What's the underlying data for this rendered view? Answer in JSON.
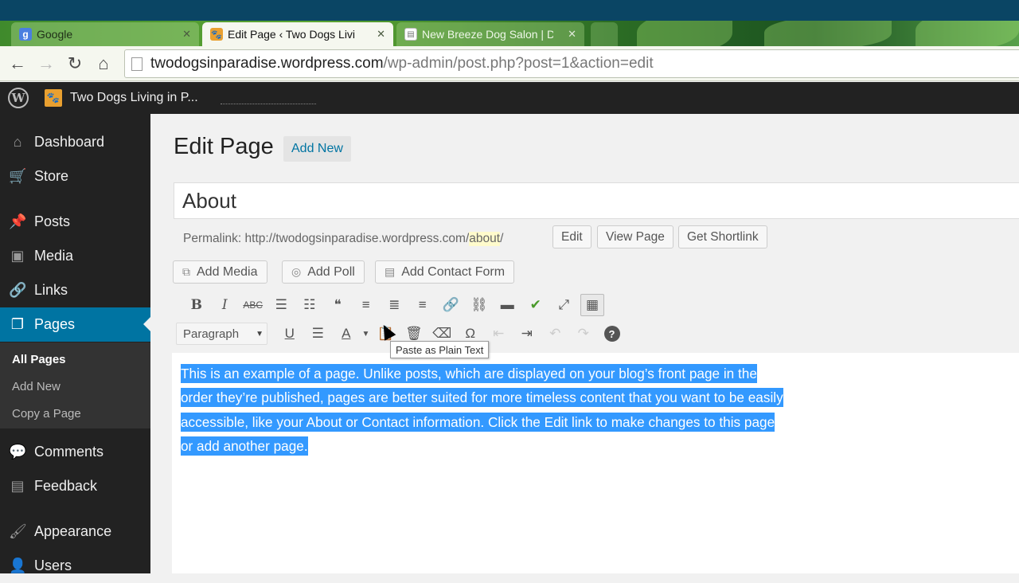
{
  "browser": {
    "tabs": [
      {
        "title": "Google",
        "favicon": "google-favicon"
      },
      {
        "title": "Edit Page ‹ Two Dogs Livi",
        "favicon": "paw-favicon",
        "active": true
      },
      {
        "title": "New Breeze Dog Salon | D",
        "favicon": "document-favicon"
      }
    ],
    "url_host": "twodogsinparadise.wordpress.com",
    "url_path": "/wp-admin/post.php?post=1&action=edit"
  },
  "adminbar": {
    "site_name": "Two Dogs Living in P..."
  },
  "sidebar": {
    "items": [
      {
        "label": "Dashboard",
        "icon": "dashboard-icon"
      },
      {
        "label": "Store",
        "icon": "cart-icon"
      },
      {
        "label": "Posts",
        "icon": "pin-icon"
      },
      {
        "label": "Media",
        "icon": "media-icon"
      },
      {
        "label": "Links",
        "icon": "link-icon"
      },
      {
        "label": "Pages",
        "icon": "pages-icon",
        "active": true
      },
      {
        "label": "Comments",
        "icon": "comment-icon"
      },
      {
        "label": "Feedback",
        "icon": "feedback-icon"
      },
      {
        "label": "Appearance",
        "icon": "brush-icon"
      },
      {
        "label": "Users",
        "icon": "user-icon"
      }
    ],
    "submenu": [
      "All Pages",
      "Add New",
      "Copy a Page"
    ]
  },
  "main": {
    "heading": "Edit Page",
    "add_new": "Add New",
    "post_title": "About",
    "permalink_label": "Permalink:",
    "permalink_url": "http://twodogsinparadise.wordpress.com/",
    "permalink_slug": "about",
    "permalink_trail": "/",
    "permalink_buttons": [
      "Edit",
      "View Page",
      "Get Shortlink"
    ],
    "media_buttons": [
      "Add Media",
      "Add Poll",
      "Add Contact Form"
    ],
    "format_select": "Paragraph",
    "tooltip": "Paste as Plain Text",
    "body_text": "This is an example of a page. Unlike posts, which are displayed on your blog’s front page in the order they’re published, pages are better suited for more timeless content that you want to be easily accessible, like your About or Contact information. Click the Edit link to make changes to this page or add another page.",
    "selection_color": "#3399ff"
  },
  "colors": {
    "admin_bar": "#222222",
    "menu_active": "#0074a2",
    "link": "#0074a2"
  }
}
